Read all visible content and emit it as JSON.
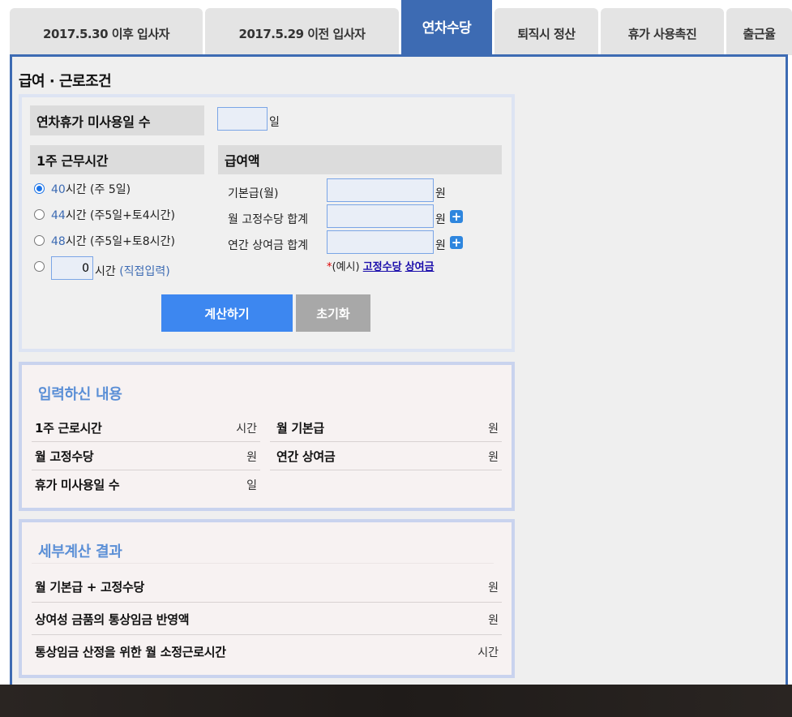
{
  "tabs": [
    {
      "label": "2017.5.30 이후 입사자"
    },
    {
      "label": "2017.5.29 이전 입사자"
    },
    {
      "label": "연차수당"
    },
    {
      "label": "퇴직시 정산"
    },
    {
      "label": "휴가 사용촉진"
    },
    {
      "label": "출근율"
    }
  ],
  "section_title": "급여 · 근로조건",
  "form": {
    "unused_leave_label": "연차휴가 미사용일 수",
    "unused_leave_value": "",
    "unused_leave_unit": "일",
    "weekly_hours_label": "1주 근무시간",
    "salary_label": "급여액",
    "hour_options": [
      {
        "number": "40",
        "text": "시간 (주 5일)",
        "checked": true
      },
      {
        "number": "44",
        "text": "시간 (주5일+토4시간)",
        "checked": false
      },
      {
        "number": "48",
        "text": "시간 (주5일+토8시간)",
        "checked": false
      }
    ],
    "custom_hours_value": "0",
    "custom_hours_unit": "시간",
    "custom_hours_hint": "(직접입력)",
    "base_pay_label": "기본급(월)",
    "fixed_allowance_label": "월 고정수당 합계",
    "bonus_label": "연간 상여금 합계",
    "currency_unit": "원",
    "plus_glyph": "+",
    "example_prefix_star": "*",
    "example_prefix": "(예시)",
    "example_link1": "고정수당",
    "example_link2": "상여금",
    "calc_button": "계산하기",
    "reset_button": "초기화"
  },
  "summary": {
    "title": "입력하신 내용",
    "weekly_hours_label": "1주 근로시간",
    "weekly_hours_unit": "시간",
    "base_pay_label": "월 기본급",
    "base_pay_unit": "원",
    "fixed_allowance_label": "월 고정수당",
    "fixed_allowance_unit": "원",
    "bonus_label": "연간 상여금",
    "bonus_unit": "원",
    "unused_leave_label": "휴가 미사용일 수",
    "unused_leave_unit": "일"
  },
  "result": {
    "title": "세부계산 결과",
    "row1_label": "월 기본급 + 고정수당",
    "row1_unit": "원",
    "row2_label": "상여성 금품의 통상임금 반영액",
    "row2_unit": "원",
    "row3_label": "통상임금 산정을 위한 월 소정근로시간",
    "row3_unit": "시간"
  },
  "colors": {
    "accent": "#3d6bb3",
    "calc_button": "#3d87f0",
    "reset_button": "#a8a8a8",
    "subtitle": "#5b8fd6"
  }
}
